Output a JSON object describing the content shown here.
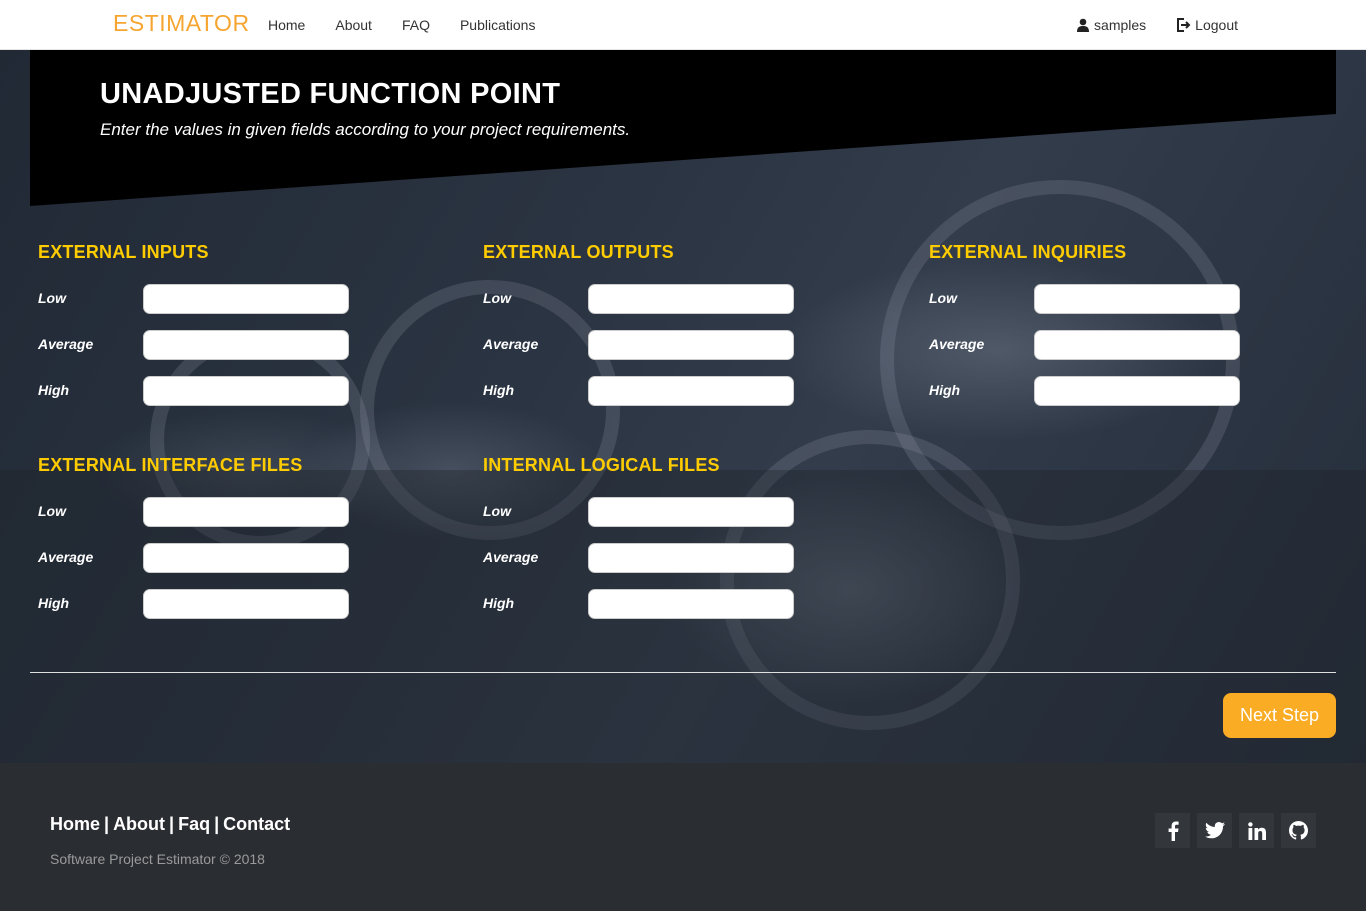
{
  "nav": {
    "logo": "ESTIMATOR",
    "links": [
      "Home",
      "About",
      "FAQ",
      "Publications"
    ],
    "user": "samples",
    "logout": "Logout"
  },
  "banner": {
    "title": "UNADJUSTED FUNCTION POINT",
    "subtitle": "Enter the values in given fields according to your project requirements."
  },
  "sections": [
    {
      "title": "EXTERNAL INPUTS",
      "fields": [
        {
          "label": "Low",
          "value": ""
        },
        {
          "label": "Average",
          "value": ""
        },
        {
          "label": "High",
          "value": ""
        }
      ]
    },
    {
      "title": "EXTERNAL OUTPUTS",
      "fields": [
        {
          "label": "Low",
          "value": ""
        },
        {
          "label": "Average",
          "value": ""
        },
        {
          "label": "High",
          "value": ""
        }
      ]
    },
    {
      "title": "EXTERNAL INQUIRIES",
      "fields": [
        {
          "label": "Low",
          "value": ""
        },
        {
          "label": "Average",
          "value": ""
        },
        {
          "label": "High",
          "value": ""
        }
      ]
    },
    {
      "title": "EXTERNAL INTERFACE FILES",
      "fields": [
        {
          "label": "Low",
          "value": ""
        },
        {
          "label": "Average",
          "value": ""
        },
        {
          "label": "High",
          "value": ""
        }
      ]
    },
    {
      "title": "INTERNAL LOGICAL FILES",
      "fields": [
        {
          "label": "Low",
          "value": ""
        },
        {
          "label": "Average",
          "value": ""
        },
        {
          "label": "High",
          "value": ""
        }
      ]
    }
  ],
  "next_button": "Next Step",
  "footer": {
    "links": [
      "Home",
      "About",
      "Faq",
      "Contact"
    ],
    "separator": "|",
    "copyright": "Software Project Estimator © 2018",
    "social_icons": [
      "facebook-icon",
      "twitter-icon",
      "linkedin-icon",
      "github-icon"
    ]
  },
  "colors": {
    "accent": "#ffcc00",
    "button": "#fbac25",
    "logo": "#f6a531",
    "banner": "#000000",
    "footer": "#2a2d31"
  }
}
